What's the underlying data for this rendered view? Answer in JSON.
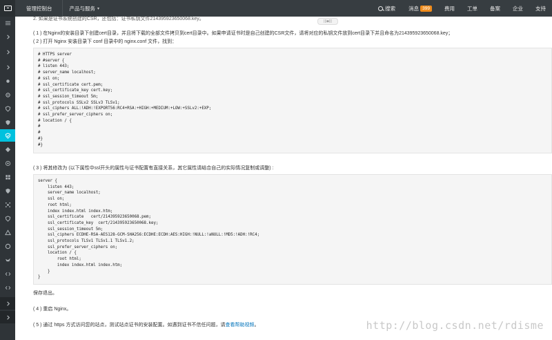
{
  "topbar": {
    "brand": "管理控制台",
    "products": "产品与服务",
    "products_caret": "▾",
    "search": "搜索",
    "messages": "消息",
    "messages_count": "399",
    "links": [
      "费用",
      "工单",
      "备案",
      "企业",
      "支持"
    ]
  },
  "content": {
    "step_top": "2. 如果是证书系统创建的CSR，还包括：证书私钥文件214395923650068.key。",
    "step1": "( 1 ) 在Nginx的安装目录下创建cert目录，并且将下载的全部文件拷贝到cert目录中。如果申请证书时是自己创建的CSR文件，请将对应的私钥文件放到cert目录下并且命名为214395923650068.key；",
    "step2": "( 2 ) 打开 Nginx 安装目录下 conf 目录中的 nginx.conf 文件，找到：",
    "code1": "# HTTPS server\n# #server {\n# listen 443;\n# server_name localhost;\n# ssl on;\n# ssl_certificate cert.pem;\n# ssl_certificate_key cert.key;\n# ssl_session_timeout 5m;\n# ssl_protocols SSLv2 SSLv3 TLSv1;\n# ssl_ciphers ALL:!ADH:!EXPORT56:RC4+RSA:+HIGH:+MEDIUM:+LOW:+SSLv2:+EXP;\n# ssl_prefer_server_ciphers on;\n# location / {\n#\n#\n#}\n#}",
    "step3": "( 3 ) 将其修改为 (以下属性中ssl开头的属性与证书配置有直接关系，其它属性请结合自己的实际情况复制或调整) :",
    "code2": "server {\n    listen 443;\n    server_name localhost;\n    ssl on;\n    root html;\n    index index.html index.htm;\n    ssl_certificate   cert/214395923650068.pem;\n    ssl_certificate_key  cert/214395923650068.key;\n    ssl_session_timeout 5m;\n    ssl_ciphers ECDHE-RSA-AES128-GCM-SHA256:ECDHE:ECDH:AES:HIGH:!NULL:!aNULL:!MD5:!ADH:!RC4;\n    ssl_protocols TLSv1 TLSv1.1 TLSv1.2;\n    ssl_prefer_server_ciphers on;\n    location / {\n        root html;\n        index index.html index.htm;\n    }\n}",
    "save_exit": "保存退出。",
    "step4": "( 4 ) 重启 Nginx。",
    "step5_prefix": "( 5 ) 通过 https 方式访问您的站点，测试站点证书的安装配置。如遇到证书不信任问题，请",
    "step5_link": "查看帮助视频",
    "step5_suffix": "。",
    "drag_handle": "|||◆|||",
    "watermark": "http://blog.csdn.net/rdisme"
  }
}
